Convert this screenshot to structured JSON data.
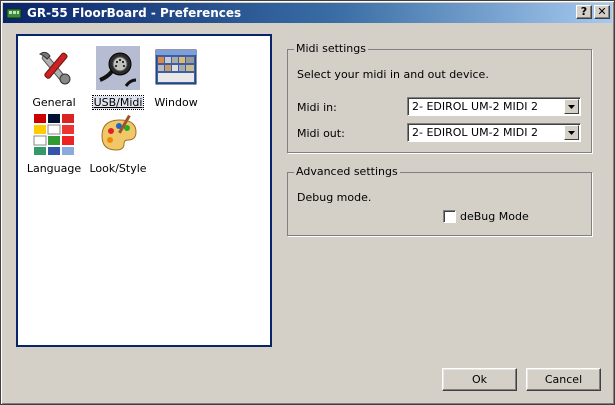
{
  "window": {
    "title": "GR-55 FloorBoard - Preferences"
  },
  "titlebar_buttons": {
    "help": "?",
    "close": "✕"
  },
  "icons": [
    {
      "label": "General",
      "icon": "tools-icon",
      "selected": false
    },
    {
      "label": "USB/Midi",
      "icon": "midi-cable-icon",
      "selected": true
    },
    {
      "label": "Window",
      "icon": "window-screenshot-icon",
      "selected": false
    },
    {
      "label": "Language",
      "icon": "flags-icon",
      "selected": false
    },
    {
      "label": "Look/Style",
      "icon": "paint-palette-icon",
      "selected": false
    }
  ],
  "midi_settings": {
    "title": "Midi settings",
    "description": "Select your midi in and out device.",
    "midi_in_label": "Midi in:",
    "midi_in_value": "2- EDIROL UM-2 MIDI 2",
    "midi_out_label": "Midi out:",
    "midi_out_value": "2- EDIROL UM-2 MIDI 2"
  },
  "advanced_settings": {
    "title": "Advanced settings",
    "debug_text": "Debug mode.",
    "debug_checkbox_label": "deBug Mode",
    "debug_checked": false
  },
  "buttons": {
    "ok": "Ok",
    "cancel": "Cancel"
  },
  "colors": {
    "title_active": "#0a246a",
    "dialog_bg": "#d4d0c8",
    "selection": "#b6bdd2"
  }
}
